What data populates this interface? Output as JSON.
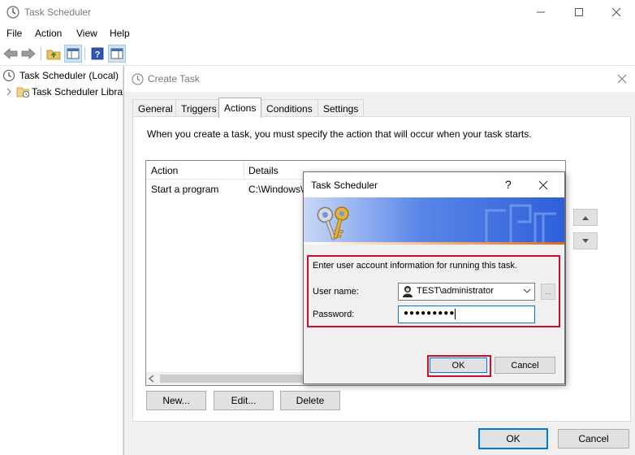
{
  "main_window": {
    "title": "Task Scheduler",
    "menu": [
      "File",
      "Action",
      "View",
      "Help"
    ]
  },
  "tree": {
    "root": "Task Scheduler (Local)",
    "child": "Task Scheduler Libra"
  },
  "create_task": {
    "title": "Create Task",
    "tabs": [
      "General",
      "Triggers",
      "Actions",
      "Conditions",
      "Settings"
    ],
    "active_tab": "Actions",
    "description": "When you create a task, you must specify the action that will occur when your task starts.",
    "table": {
      "headers": [
        "Action",
        "Details"
      ],
      "rows": [
        {
          "action": "Start a program",
          "details": "C:\\Windows\\"
        }
      ]
    },
    "buttons": {
      "new": "New...",
      "edit": "Edit...",
      "delete": "Delete"
    },
    "footer": {
      "ok": "OK",
      "cancel": "Cancel"
    }
  },
  "dialog": {
    "title": "Task Scheduler",
    "help_glyph": "?",
    "prompt": "Enter user account information for running this task.",
    "username_label": "User name:",
    "username_value": "TEST\\administrator",
    "password_label": "Password:",
    "password_mask": "●●●●●●●●●",
    "browse_glyph": "...",
    "ok": "OK",
    "cancel": "Cancel"
  },
  "colors": {
    "highlight_box": "#c8102e",
    "banner": "#2d5fd8",
    "focus_border": "#0078d7"
  }
}
